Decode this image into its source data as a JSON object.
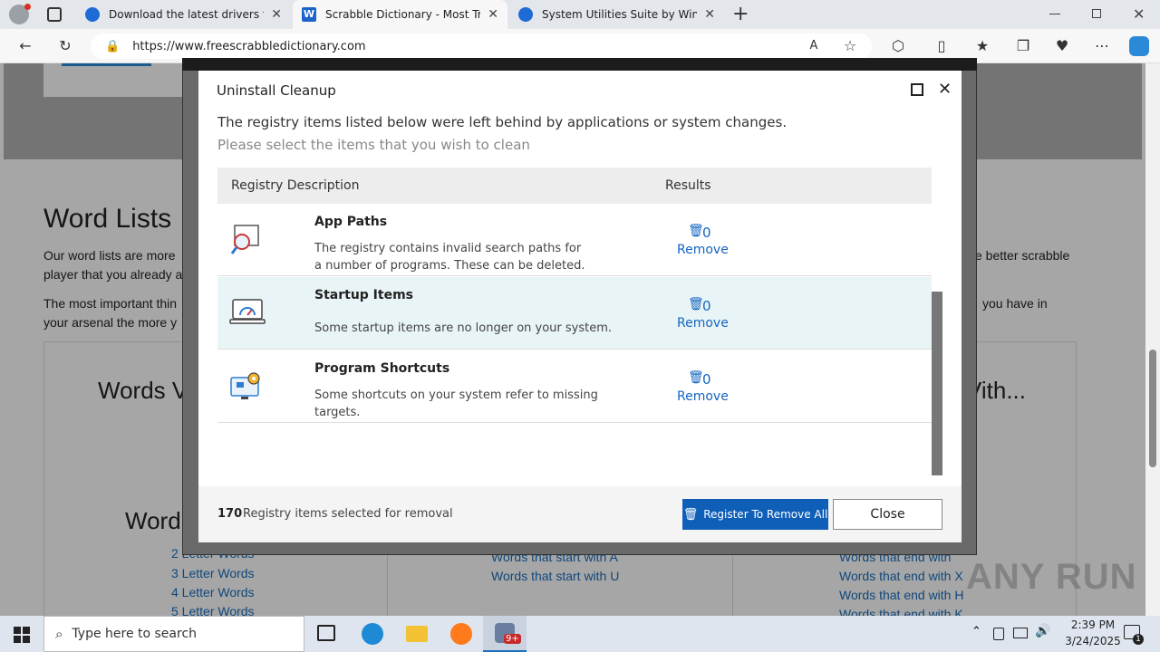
{
  "browser": {
    "tabs": [
      {
        "title": "Download the latest drivers for yo",
        "favicon_color": "#1e6bd6"
      },
      {
        "title": "Scrabble Dictionary - Most Truste",
        "favicon_color": "#1c64c9"
      },
      {
        "title": "System Utilities Suite by WinZip",
        "favicon_color": "#1e6bd6"
      }
    ],
    "new_tab": "+",
    "url": "https://www.freescrabbledictionary.com"
  },
  "page": {
    "heading": "Word Lists",
    "para1_left": "Our word lists are more",
    "para1_left2": "player that you already a",
    "para1_right": "e better scrabble",
    "para2_left": "The most important thin",
    "para2_left2": "your arsenal the more y",
    "para2_right": "you have in",
    "words_with_heading": "Words V",
    "words_with_right": "Vith...",
    "word_heading2": "Word",
    "col1_links": [
      "2 Letter Words",
      "3 Letter Words",
      "4 Letter Words",
      "5 Letter Words"
    ],
    "col2_links": [
      "Words that start with A",
      "Words that start with U"
    ],
    "col3_links": [
      "Words that end with ",
      "Words that end with X",
      "Words that end with H",
      "Words that end with K"
    ],
    "watermark": "ANY RUN"
  },
  "dialog": {
    "title": "Uninstall Cleanup",
    "intro_line1": "The registry items listed below were left behind by applications or system changes.",
    "intro_line2": "Please select the items that you wish to clean",
    "col_desc": "Registry Description",
    "col_results": "Results",
    "rows": [
      {
        "title": "App Paths",
        "desc": "The registry contains invalid search paths for a number of programs. These can be deleted.",
        "count": "0",
        "action": "Remove"
      },
      {
        "title": "Startup Items",
        "desc": "Some startup items are no longer on your system.",
        "count": "0",
        "action": "Remove"
      },
      {
        "title": "Program Shortcuts",
        "desc": "Some shortcuts on your system refer to missing targets.",
        "count": "0",
        "action": "Remove"
      }
    ],
    "footer_count": "170",
    "footer_text": "Registry items selected for removal",
    "register_button": "Register To Remove All",
    "close_button": "Close"
  },
  "taskbar": {
    "search_placeholder": "Type here to search",
    "time": "2:39 PM",
    "date": "3/24/2025",
    "badge": "9+",
    "notif_count": "1"
  }
}
